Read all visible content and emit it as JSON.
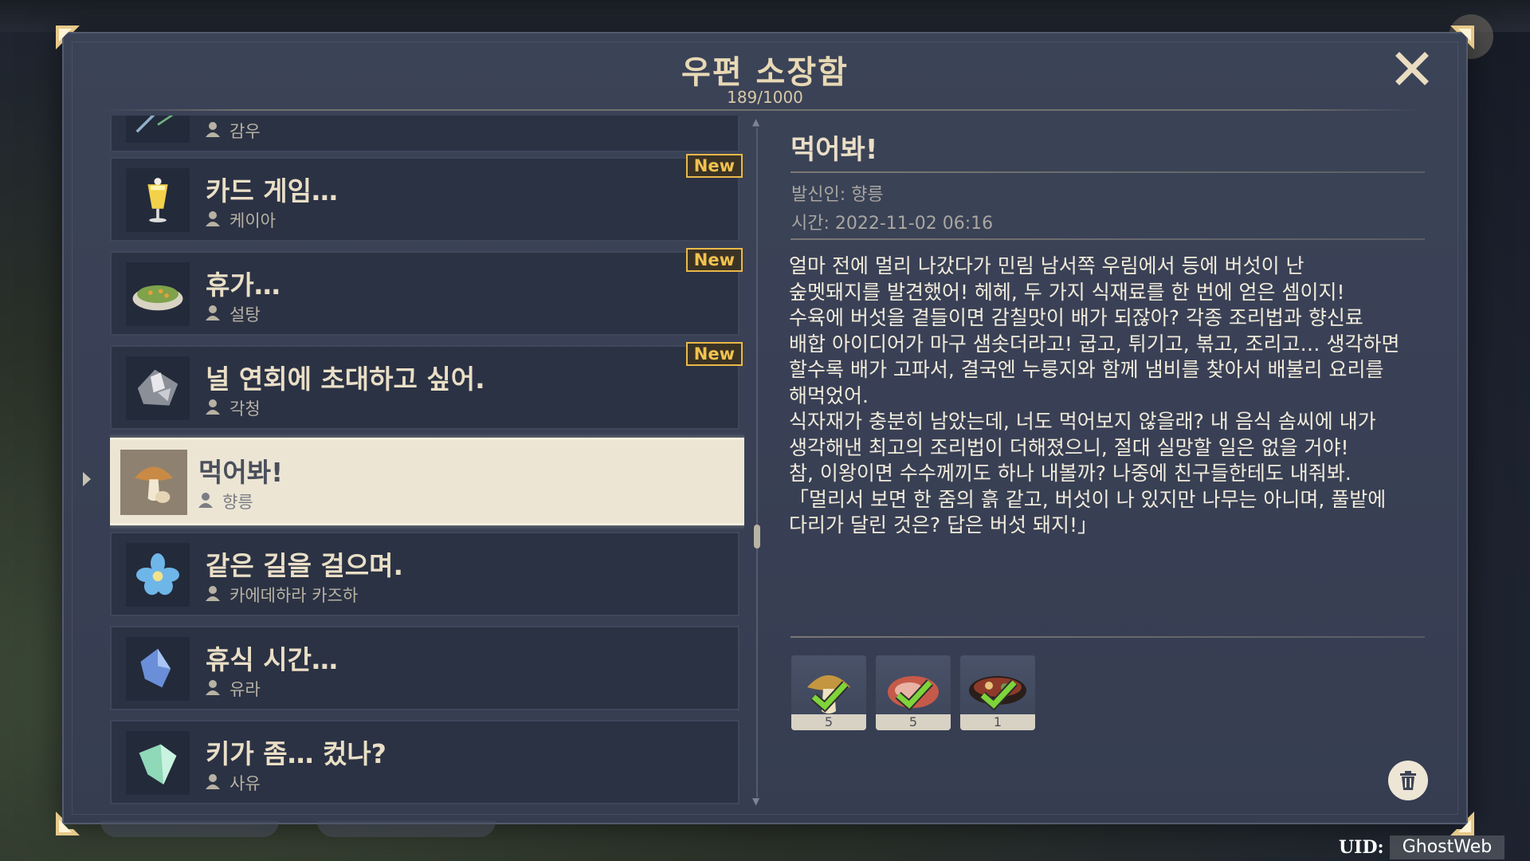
{
  "window": {
    "title": "우편 소장함",
    "count": "189/1000"
  },
  "mail_list": [
    {
      "subject": "",
      "sender": "감우",
      "is_new": false,
      "icon": "sword-icon"
    },
    {
      "subject": "카드 게임…",
      "sender": "케이아",
      "is_new": true,
      "icon": "drink-icon"
    },
    {
      "subject": "휴가…",
      "sender": "설탕",
      "is_new": true,
      "icon": "food-dish-icon"
    },
    {
      "subject": "널 연회에 초대하고 싶어.",
      "sender": "각청",
      "is_new": true,
      "icon": "rock-ore-icon"
    },
    {
      "subject": "먹어봐!",
      "sender": "향릉",
      "is_new": false,
      "icon": "mushroom-icon",
      "selected": true
    },
    {
      "subject": "같은 길을 걸으며.",
      "sender": "카에데하라 카즈하",
      "is_new": false,
      "icon": "flower-icon"
    },
    {
      "subject": "휴식 시간…",
      "sender": "유라",
      "is_new": false,
      "icon": "crystal-icon"
    },
    {
      "subject": "키가 좀… 컸나?",
      "sender": "사유",
      "is_new": false,
      "icon": "leaf-crystal-icon"
    }
  ],
  "new_badge_label": "New",
  "detail": {
    "title": "먹어봐!",
    "sender_line": "발신인: 향릉",
    "time_line": "시간: 2022-11-02 06:16",
    "body": "얼마 전에 멀리 나갔다가 민림 남서쪽 우림에서 등에 버섯이 난\n숲멧돼지를 발견했어! 헤헤, 두 가지 식재료를 한 번에 얻은 셈이지!\n수육에 버섯을 곁들이면 감칠맛이 배가 되잖아? 각종 조리법과 향신료\n배합 아이디어가 마구 샘솟더라고! 굽고, 튀기고, 볶고, 조리고… 생각하면\n할수록 배가 고파서, 결국엔 누룽지와 함께 냄비를 찾아서 배불리 요리를\n해먹었어.\n식자재가 충분히 남았는데, 너도 먹어보지 않을래? 내 음식 솜씨에 내가\n생각해낸 최고의 조리법이 더해졌으니, 절대 실망할 일은 없을 거야!\n참, 이왕이면 수수께끼도 하나 내볼까? 나중에 친구들한테도 내줘봐.\n「멀리서 보면 한 줌의 흙 같고, 버섯이 나 있지만 나무는 아니며, 풀밭에\n다리가 달린 것은? 답은 버섯 돼지!」"
  },
  "rewards": [
    {
      "icon": "mushroom-icon",
      "qty": "5",
      "claimed": true
    },
    {
      "icon": "raw-meat-icon",
      "qty": "5",
      "claimed": true
    },
    {
      "icon": "stew-dish-icon",
      "qty": "1",
      "claimed": true
    }
  ],
  "uid": {
    "label": "UID:",
    "value": "GhostWeb"
  },
  "colors": {
    "panel": "#394055",
    "title": "#e8d9b5",
    "new_badge": "#e9b949",
    "selected_row": "#ece5d4"
  }
}
